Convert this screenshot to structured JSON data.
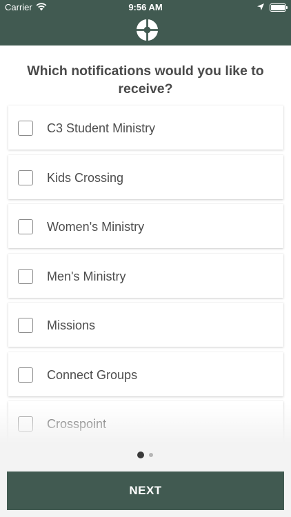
{
  "status_bar": {
    "carrier": "Carrier",
    "time": "9:56 AM"
  },
  "header": {
    "logo_icon": "cross-circle-logo-icon"
  },
  "main": {
    "heading": "Which notifications would you like to receive?",
    "options": [
      {
        "label": "C3 Student Ministry",
        "checked": false
      },
      {
        "label": "Kids Crossing",
        "checked": false
      },
      {
        "label": "Women's Ministry",
        "checked": false
      },
      {
        "label": "Men's Ministry",
        "checked": false
      },
      {
        "label": "Missions",
        "checked": false
      },
      {
        "label": "Connect Groups",
        "checked": false
      },
      {
        "label": "Crosspoint",
        "checked": false
      }
    ]
  },
  "pager": {
    "current_page": 1,
    "total_pages": 2
  },
  "footer": {
    "next_label": "NEXT"
  },
  "colors": {
    "brand": "#415a51",
    "text": "#4d4d4d",
    "background": "#f3f3f3"
  }
}
